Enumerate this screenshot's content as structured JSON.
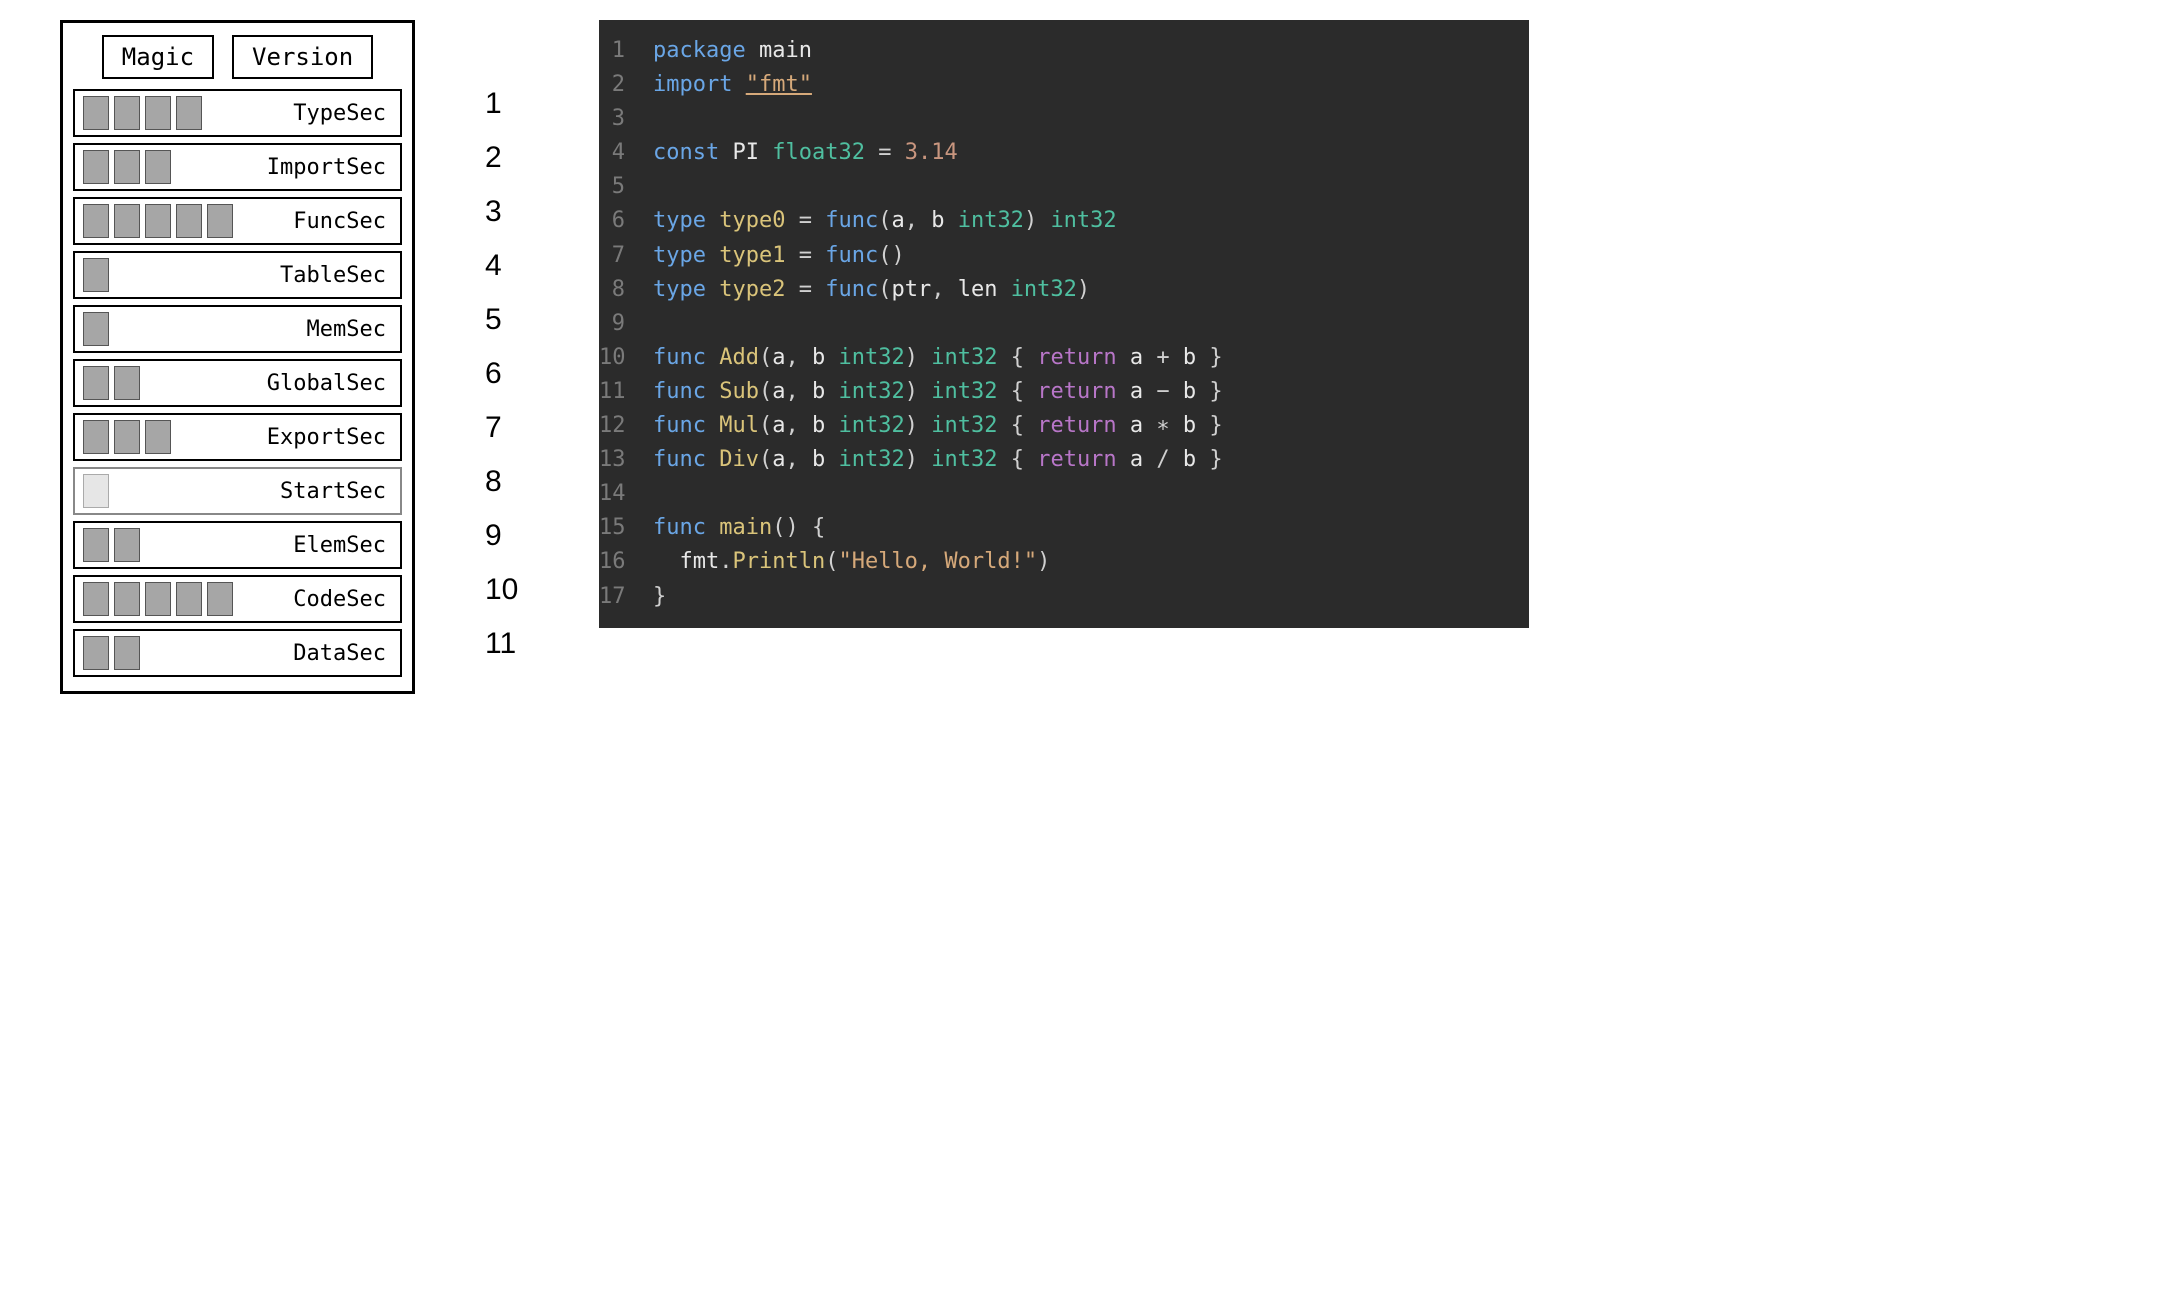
{
  "module": {
    "header": [
      {
        "label": "Magic"
      },
      {
        "label": "Version"
      }
    ],
    "sections": [
      {
        "name": "TypeSec",
        "blocks": 4,
        "num": "1",
        "faded": false
      },
      {
        "name": "ImportSec",
        "blocks": 3,
        "num": "2",
        "faded": false
      },
      {
        "name": "FuncSec",
        "blocks": 5,
        "num": "3",
        "faded": false
      },
      {
        "name": "TableSec",
        "blocks": 1,
        "num": "4",
        "faded": false
      },
      {
        "name": "MemSec",
        "blocks": 1,
        "num": "5",
        "faded": false
      },
      {
        "name": "GlobalSec",
        "blocks": 2,
        "num": "6",
        "faded": false
      },
      {
        "name": "ExportSec",
        "blocks": 3,
        "num": "7",
        "faded": false
      },
      {
        "name": "StartSec",
        "blocks": 1,
        "num": "8",
        "faded": true
      },
      {
        "name": "ElemSec",
        "blocks": 2,
        "num": "9",
        "faded": false
      },
      {
        "name": "CodeSec",
        "blocks": 5,
        "num": "10",
        "faded": false
      },
      {
        "name": "DataSec",
        "blocks": 2,
        "num": "11",
        "faded": false
      }
    ]
  },
  "code": {
    "lines": [
      {
        "n": "1",
        "tokens": [
          {
            "t": "package ",
            "c": "kw"
          },
          {
            "t": "main",
            "c": "ident"
          }
        ]
      },
      {
        "n": "2",
        "tokens": [
          {
            "t": "import ",
            "c": "kw"
          },
          {
            "t": "\"fmt\"",
            "c": "str underline"
          }
        ]
      },
      {
        "n": "3",
        "tokens": []
      },
      {
        "n": "4",
        "tokens": [
          {
            "t": "const ",
            "c": "kw"
          },
          {
            "t": "PI ",
            "c": "ident"
          },
          {
            "t": "float32 ",
            "c": "type"
          },
          {
            "t": "= ",
            "c": "punc"
          },
          {
            "t": "3.14",
            "c": "num"
          }
        ]
      },
      {
        "n": "5",
        "tokens": []
      },
      {
        "n": "6",
        "tokens": [
          {
            "t": "type ",
            "c": "kw"
          },
          {
            "t": "type0 ",
            "c": "func"
          },
          {
            "t": "= ",
            "c": "punc"
          },
          {
            "t": "func",
            "c": "kw"
          },
          {
            "t": "(",
            "c": "punc"
          },
          {
            "t": "a",
            "c": "ident"
          },
          {
            "t": ", ",
            "c": "punc"
          },
          {
            "t": "b ",
            "c": "ident"
          },
          {
            "t": "int32",
            "c": "type"
          },
          {
            "t": ") ",
            "c": "punc"
          },
          {
            "t": "int32",
            "c": "type"
          }
        ]
      },
      {
        "n": "7",
        "tokens": [
          {
            "t": "type ",
            "c": "kw"
          },
          {
            "t": "type1 ",
            "c": "func"
          },
          {
            "t": "= ",
            "c": "punc"
          },
          {
            "t": "func",
            "c": "kw"
          },
          {
            "t": "()",
            "c": "punc"
          }
        ]
      },
      {
        "n": "8",
        "tokens": [
          {
            "t": "type ",
            "c": "kw"
          },
          {
            "t": "type2 ",
            "c": "func"
          },
          {
            "t": "= ",
            "c": "punc"
          },
          {
            "t": "func",
            "c": "kw"
          },
          {
            "t": "(",
            "c": "punc"
          },
          {
            "t": "ptr",
            "c": "ident"
          },
          {
            "t": ", ",
            "c": "punc"
          },
          {
            "t": "len ",
            "c": "ident"
          },
          {
            "t": "int32",
            "c": "type"
          },
          {
            "t": ")",
            "c": "punc"
          }
        ]
      },
      {
        "n": "9",
        "tokens": []
      },
      {
        "n": "10",
        "tokens": [
          {
            "t": "func ",
            "c": "kw"
          },
          {
            "t": "Add",
            "c": "func"
          },
          {
            "t": "(",
            "c": "punc"
          },
          {
            "t": "a",
            "c": "ident"
          },
          {
            "t": ", ",
            "c": "punc"
          },
          {
            "t": "b ",
            "c": "ident"
          },
          {
            "t": "int32",
            "c": "type"
          },
          {
            "t": ") ",
            "c": "punc"
          },
          {
            "t": "int32 ",
            "c": "type"
          },
          {
            "t": "{ ",
            "c": "punc"
          },
          {
            "t": "return ",
            "c": "ret"
          },
          {
            "t": "a ",
            "c": "ident"
          },
          {
            "t": "+ ",
            "c": "punc"
          },
          {
            "t": "b ",
            "c": "ident"
          },
          {
            "t": "}",
            "c": "punc"
          }
        ]
      },
      {
        "n": "11",
        "tokens": [
          {
            "t": "func ",
            "c": "kw"
          },
          {
            "t": "Sub",
            "c": "func"
          },
          {
            "t": "(",
            "c": "punc"
          },
          {
            "t": "a",
            "c": "ident"
          },
          {
            "t": ", ",
            "c": "punc"
          },
          {
            "t": "b ",
            "c": "ident"
          },
          {
            "t": "int32",
            "c": "type"
          },
          {
            "t": ") ",
            "c": "punc"
          },
          {
            "t": "int32 ",
            "c": "type"
          },
          {
            "t": "{ ",
            "c": "punc"
          },
          {
            "t": "return ",
            "c": "ret"
          },
          {
            "t": "a ",
            "c": "ident"
          },
          {
            "t": "− ",
            "c": "punc"
          },
          {
            "t": "b ",
            "c": "ident"
          },
          {
            "t": "}",
            "c": "punc"
          }
        ]
      },
      {
        "n": "12",
        "tokens": [
          {
            "t": "func ",
            "c": "kw"
          },
          {
            "t": "Mul",
            "c": "func"
          },
          {
            "t": "(",
            "c": "punc"
          },
          {
            "t": "a",
            "c": "ident"
          },
          {
            "t": ", ",
            "c": "punc"
          },
          {
            "t": "b ",
            "c": "ident"
          },
          {
            "t": "int32",
            "c": "type"
          },
          {
            "t": ") ",
            "c": "punc"
          },
          {
            "t": "int32 ",
            "c": "type"
          },
          {
            "t": "{ ",
            "c": "punc"
          },
          {
            "t": "return ",
            "c": "ret"
          },
          {
            "t": "a ",
            "c": "ident"
          },
          {
            "t": "∗ ",
            "c": "punc"
          },
          {
            "t": "b ",
            "c": "ident"
          },
          {
            "t": "}",
            "c": "punc"
          }
        ]
      },
      {
        "n": "13",
        "tokens": [
          {
            "t": "func ",
            "c": "kw"
          },
          {
            "t": "Div",
            "c": "func"
          },
          {
            "t": "(",
            "c": "punc"
          },
          {
            "t": "a",
            "c": "ident"
          },
          {
            "t": ", ",
            "c": "punc"
          },
          {
            "t": "b ",
            "c": "ident"
          },
          {
            "t": "int32",
            "c": "type"
          },
          {
            "t": ") ",
            "c": "punc"
          },
          {
            "t": "int32 ",
            "c": "type"
          },
          {
            "t": "{ ",
            "c": "punc"
          },
          {
            "t": "return ",
            "c": "ret"
          },
          {
            "t": "a ",
            "c": "ident"
          },
          {
            "t": "/ ",
            "c": "punc"
          },
          {
            "t": "b ",
            "c": "ident"
          },
          {
            "t": "}",
            "c": "punc"
          }
        ]
      },
      {
        "n": "14",
        "tokens": []
      },
      {
        "n": "15",
        "tokens": [
          {
            "t": "func ",
            "c": "kw"
          },
          {
            "t": "main",
            "c": "func"
          },
          {
            "t": "() {",
            "c": "punc"
          }
        ]
      },
      {
        "n": "16",
        "tokens": [
          {
            "t": "  fmt",
            "c": "ident"
          },
          {
            "t": ".",
            "c": "punc"
          },
          {
            "t": "Println",
            "c": "func"
          },
          {
            "t": "(",
            "c": "punc"
          },
          {
            "t": "\"Hello, World!\"",
            "c": "str"
          },
          {
            "t": ")",
            "c": "punc"
          }
        ]
      },
      {
        "n": "17",
        "tokens": [
          {
            "t": "}",
            "c": "punc"
          }
        ]
      }
    ]
  }
}
